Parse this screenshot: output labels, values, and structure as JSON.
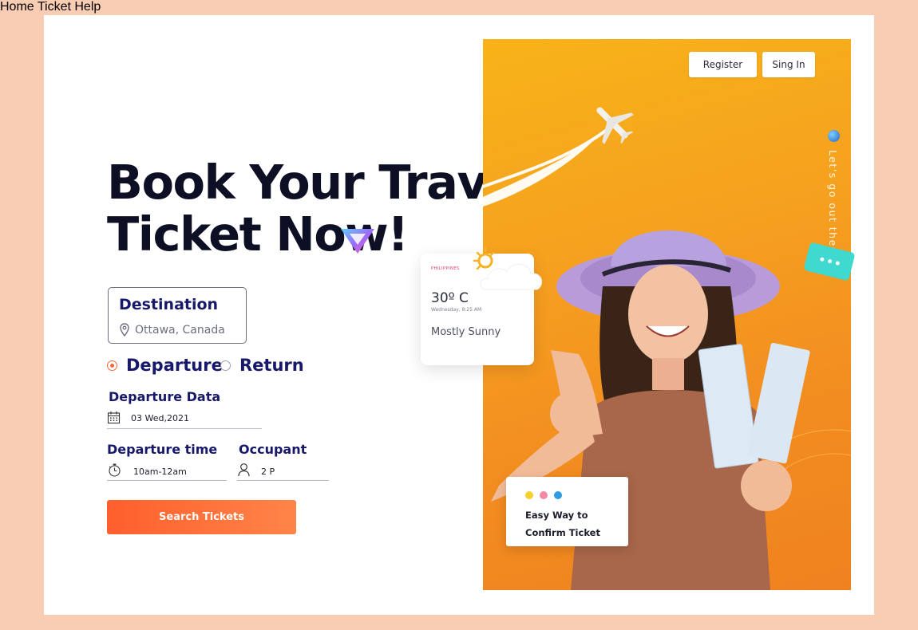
{
  "nav": {
    "items": [
      "Home",
      "Ticket",
      "Help"
    ]
  },
  "header": {
    "register_label": "Register",
    "signin_label": "Sing In"
  },
  "hero": {
    "title_line1": "Book Your Travel",
    "title_line2": "Ticket Now!",
    "tagline": "Let's go out there",
    "accent_color": "#f7a61c"
  },
  "form": {
    "destination_label": "Destination",
    "destination_value": "Ottawa, Canada",
    "radio_departure": "Departure",
    "radio_return": "Return",
    "selected_trip": "Departure",
    "departure_date_label": "Departure Data",
    "departure_date_value": "03 Wed,2021",
    "departure_time_label": "Departure time",
    "departure_time_value": "10am-12am",
    "occupant_label": "Occupant",
    "occupant_value": "2 P",
    "search_label": "Search Tickets",
    "button_color": "#ff6a35"
  },
  "weather": {
    "location": "PHILIPPINES",
    "temperature": "30º C",
    "datetime": "Wednesday, 8:25 AM",
    "condition": "Mostly Sunny"
  },
  "confirm_card": {
    "text": "Easy Way to Confirm Ticket",
    "dot_colors": [
      "#f5cf2e",
      "#f28aa5",
      "#2f9be0"
    ]
  }
}
